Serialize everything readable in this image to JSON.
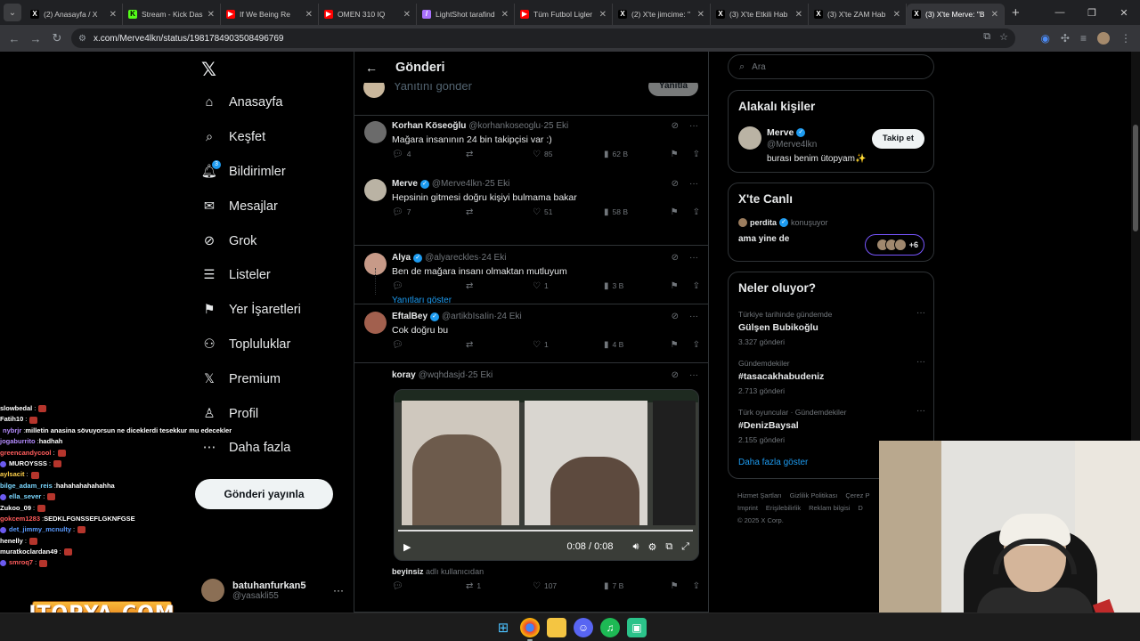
{
  "browser": {
    "tabs": [
      {
        "label": "(2) Anasayfa / X",
        "icon": "x-logo-icon",
        "color": "#000000"
      },
      {
        "label": "Stream - Kick Das",
        "icon": "kick-icon",
        "color": "#53fc18"
      },
      {
        "label": "If We Being Re",
        "icon": "youtube-icon",
        "color": "#ff0000"
      },
      {
        "label": "OMEN 310 IQ",
        "icon": "youtube-icon",
        "color": "#ff0000"
      },
      {
        "label": "LightShot tarafind",
        "icon": "lightshot-icon",
        "color": "#a970ff"
      },
      {
        "label": "Tüm Futbol Ligler",
        "icon": "youtube-icon",
        "color": "#ff0000"
      },
      {
        "label": "(2) X'te jimcime: \"",
        "icon": "x-logo-icon",
        "color": "#000000"
      },
      {
        "label": "(3) X'te Etkili Hab",
        "icon": "x-logo-icon",
        "color": "#000000"
      },
      {
        "label": "(3) X'te ZAM Hab",
        "icon": "x-logo-icon",
        "color": "#000000"
      },
      {
        "label": "(3) X'te Merve: \"B",
        "icon": "x-logo-icon",
        "color": "#000000",
        "active": true
      }
    ],
    "url": "x.com/Merve4lkn/status/1981784903508496769"
  },
  "nav": {
    "items": [
      {
        "label": "Anasayfa",
        "icon": "home-icon"
      },
      {
        "label": "Keşfet",
        "icon": "search-icon"
      },
      {
        "label": "Bildirimler",
        "icon": "bell-icon",
        "badge": "3"
      },
      {
        "label": "Mesajlar",
        "icon": "mail-icon"
      },
      {
        "label": "Grok",
        "icon": "grok-icon"
      },
      {
        "label": "Listeler",
        "icon": "list-icon"
      },
      {
        "label": "Yer İşaretleri",
        "icon": "bookmark-icon"
      },
      {
        "label": "Topluluklar",
        "icon": "communities-icon"
      },
      {
        "label": "Premium",
        "icon": "x-logo-icon"
      },
      {
        "label": "Profil",
        "icon": "profile-icon"
      },
      {
        "label": "Daha fazla",
        "icon": "more-circle-icon"
      }
    ],
    "post_button": "Gönderi yayınla",
    "user": {
      "name": "batuhanfurkan5",
      "handle": "@yasakli55"
    }
  },
  "main": {
    "title": "Gönderi",
    "reply_placeholder": "Yanıtını gönder",
    "reply_button": "Yanıtla",
    "show_replies": "Yanıtları göster",
    "tweets": [
      {
        "name": "Korhan Köseoğlu",
        "verified": false,
        "handle": "@korhankoseoglu",
        "date": "25 Eki",
        "text": "Mağara insanının 24 bin takipçisi var :)",
        "replies": "4",
        "retweets": "",
        "likes": "85",
        "views": "62 B",
        "avatar": "#6b6b6b"
      },
      {
        "name": "Merve",
        "verified": true,
        "handle": "@Merve4lkn",
        "date": "25 Eki",
        "text": "Hepsinin gitmesi doğru kişiyi bulmama bakar",
        "replies": "7",
        "retweets": "",
        "likes": "51",
        "views": "58 B",
        "avatar": "#bab3a4"
      },
      {
        "name": "Alya",
        "verified": true,
        "handle": "@alyareckles",
        "date": "24 Eki",
        "text": "Ben de mağara insanı olmaktan mutluyum",
        "replies": "",
        "retweets": "",
        "likes": "1",
        "views": "3 B",
        "avatar": "#c79a88"
      },
      {
        "name": "EftalBey",
        "verified": true,
        "handle": "@artikbIsaIin",
        "date": "24 Eki",
        "text": "Cok doğru bu",
        "replies": "",
        "retweets": "",
        "likes": "1",
        "views": "4 B",
        "avatar": "#a2604e"
      },
      {
        "name": "koray",
        "verified": false,
        "handle": "@wqhdasjd",
        "date": "25 Eki",
        "text": "",
        "replies": "",
        "retweets": "1",
        "likes": "107",
        "views": "7 B",
        "avatar": "#000000"
      }
    ],
    "video": {
      "time": "0:08 / 0:08",
      "progress": 1.0,
      "source_user": "beyinsiz",
      "source_suffix": "adlı kullanıcıdan"
    }
  },
  "sidebar": {
    "search_placeholder": "Ara",
    "people": {
      "heading": "Alakalı kişiler",
      "name": "Merve",
      "handle": "@Merve4lkn",
      "bio": "burası benim ütopyam✨",
      "follow": "Takip et"
    },
    "live": {
      "heading": "X'te Canlı",
      "host": "perdita",
      "host_sub": "konuşuyor",
      "title": "ama yine de",
      "extra": "+6"
    },
    "trends": {
      "heading": "Neler oluyor?",
      "items": [
        {
          "context": "Türkiye tarihinde gündemde",
          "title": "Gülşen Bubikoğlu",
          "count": "3.327 gönderi"
        },
        {
          "context": "Gündemdekiler",
          "title": "#tasacakhabudeniz",
          "count": "2.713 gönderi"
        },
        {
          "context": "Türk oyuncular · Gündemdekiler",
          "title": "#DenizBaysal",
          "count": "2.155 gönderi"
        }
      ],
      "show_more": "Daha fazla göster"
    },
    "footer": [
      "Hizmet Şartları",
      "Gizlilik Politikası",
      "Çerez P",
      "Imprint",
      "Erişilebilirlik",
      "Reklam bilgisi",
      "D",
      "© 2025 X Corp."
    ]
  },
  "chat": [
    {
      "user": "slowbedal",
      "msg": "",
      "color": "#ffffff"
    },
    {
      "user": "Fatih10",
      "msg": "",
      "color": "#ffffff"
    },
    {
      "user": "nybrjr",
      "msg": "milletin anasina sövuyorsun ne diceklerdi tesekkur mu edeceklerdi",
      "color": "#b58cff"
    },
    {
      "user": "jogaburrito",
      "msg": "hadhah",
      "color": "#b58cff"
    },
    {
      "user": "greencandycool",
      "msg": "",
      "color": "#ff5c5c"
    },
    {
      "user": "MUROYSSS",
      "msg": "",
      "color": "#ffffff"
    },
    {
      "user": "aylsacit",
      "msg": "",
      "color": "#ffd14a"
    },
    {
      "user": "bilge_adam_reis",
      "msg": "hahahahahahahha",
      "color": "#7ad7ff"
    },
    {
      "user": "ella_sever",
      "msg": "",
      "color": "#7ad7ff"
    },
    {
      "user": "Zukoo_09",
      "msg": "",
      "color": "#ffffff"
    },
    {
      "user": "gokcem1283",
      "msg": "SEDKLFGNSSEFLGKNFGSE",
      "color": "#ff5c5c"
    },
    {
      "user": "det_jimmy_mcnulty",
      "msg": "",
      "color": "#5b9bff"
    },
    {
      "user": "henelly",
      "msg": "",
      "color": "#ffffff"
    },
    {
      "user": "muratkoclardan49",
      "msg": "",
      "color": "#ffffff"
    },
    {
      "user": "smroq7",
      "msg": "",
      "color": "#ff5c5c"
    }
  ],
  "overlay_logo": "ITOPYA.COM"
}
